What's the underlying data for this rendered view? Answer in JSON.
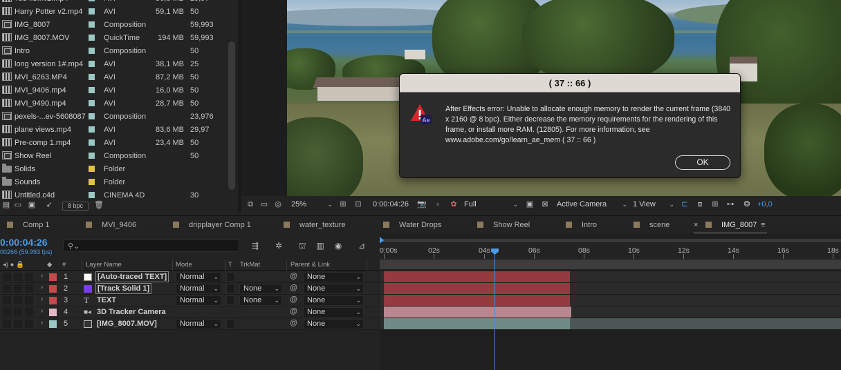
{
  "project": {
    "items": [
      {
        "name": "Ted fle...v2.mp4",
        "type": "AVI",
        "size": "56,8 MB",
        "fps": "29,97",
        "icon": "footage",
        "color": "#9bc7c4"
      },
      {
        "name": "Harry Potter v2.mp4",
        "type": "AVI",
        "size": "59,1 MB",
        "fps": "50",
        "icon": "footage",
        "color": "#9bc7c4"
      },
      {
        "name": "IMG_8007",
        "type": "Composition",
        "size": "",
        "fps": "59,993",
        "icon": "comp",
        "color": "#9bc7c4"
      },
      {
        "name": "IMG_8007.MOV",
        "type": "QuickTime",
        "size": "194 MB",
        "fps": "59,993",
        "icon": "footage",
        "color": "#9bc7c4"
      },
      {
        "name": "Intro",
        "type": "Composition",
        "size": "",
        "fps": "50",
        "icon": "comp",
        "color": "#9bc7c4"
      },
      {
        "name": "long version 1#.mp4",
        "type": "AVI",
        "size": "38,1 MB",
        "fps": "25",
        "icon": "footage",
        "color": "#9bc7c4"
      },
      {
        "name": "MVI_6263.MP4",
        "type": "AVI",
        "size": "87,2 MB",
        "fps": "50",
        "icon": "footage",
        "color": "#9bc7c4"
      },
      {
        "name": "MVI_9406.mp4",
        "type": "AVI",
        "size": "16,0 MB",
        "fps": "50",
        "icon": "footage",
        "color": "#9bc7c4"
      },
      {
        "name": "MVI_9490.mp4",
        "type": "AVI",
        "size": "28,7 MB",
        "fps": "50",
        "icon": "footage",
        "color": "#9bc7c4"
      },
      {
        "name": "pexels-...ev-5608087",
        "type": "Composition",
        "size": "",
        "fps": "23,976",
        "icon": "comp",
        "color": "#9bc7c4"
      },
      {
        "name": "plane views.mp4",
        "type": "AVI",
        "size": "83,6 MB",
        "fps": "29,97",
        "icon": "footage",
        "color": "#9bc7c4"
      },
      {
        "name": "Pre-comp 1.mp4",
        "type": "AVI",
        "size": "23,4 MB",
        "fps": "50",
        "icon": "footage",
        "color": "#9bc7c4"
      },
      {
        "name": "Show Reel",
        "type": "Composition",
        "size": "",
        "fps": "50",
        "icon": "comp",
        "color": "#9bc7c4"
      },
      {
        "name": "Solids",
        "type": "Folder",
        "size": "",
        "fps": "",
        "icon": "folder",
        "color": "#e0c43a"
      },
      {
        "name": "Sounds",
        "type": "Folder",
        "size": "",
        "fps": "",
        "icon": "folder",
        "color": "#e0c43a"
      },
      {
        "name": "Untitled.c4d",
        "type": "CINEMA 4D",
        "size": "",
        "fps": "30",
        "icon": "footage",
        "color": "#9bc7c4"
      }
    ],
    "bpc_label": "8 bpc"
  },
  "viewer": {
    "zoom": "25%",
    "timecode": "0:00:04:26",
    "resolution": "Full",
    "camera": "Active Camera",
    "views": "1 View",
    "exposure": "+0,0"
  },
  "dialog": {
    "title": "( 37 :: 66 )",
    "message": "After Effects error: Unable to allocate enough memory to render the current frame (3840 x 2160 @ 8 bpc). Either decrease the memory requirements for the rendering of this frame, or install more RAM. (12805). For more information, see www.adobe.com/go/learn_ae_mem ( 37 :: 66 )",
    "ok_label": "OK",
    "icon_badge": "Ae"
  },
  "tabs": [
    {
      "label": "Comp 1"
    },
    {
      "label": "MVI_9406"
    },
    {
      "label": "dripplayer Comp 1"
    },
    {
      "label": "water_texture"
    },
    {
      "label": "Water Drops"
    },
    {
      "label": "Show Reel"
    },
    {
      "label": "Intro"
    },
    {
      "label": "scene"
    },
    {
      "label": "IMG_8007",
      "active": true
    }
  ],
  "tab_close": "×",
  "tab_menu": "≡",
  "timeline": {
    "current_time": "0:00:04:26",
    "frame_info": "00266 (59.993 fps)",
    "columns": {
      "hash": "#",
      "layer_name": "Layer Name",
      "mode": "Mode",
      "t": "T",
      "trkmat": "TrkMat",
      "parent": "Parent & Link"
    },
    "layers": [
      {
        "num": "1",
        "name": "[Auto-traced TEXT]",
        "mode": "Normal",
        "trkmat": "",
        "parent": "None",
        "color": "#c24a4a",
        "icon": "white-solid"
      },
      {
        "num": "2",
        "name": "[Track Solid 1]",
        "mode": "Normal",
        "trkmat": "None",
        "parent": "None",
        "color": "#c24a4a",
        "icon": "purple-solid"
      },
      {
        "num": "3",
        "name": "TEXT",
        "mode": "Normal",
        "trkmat": "None",
        "parent": "None",
        "color": "#c24a4a",
        "icon": "text"
      },
      {
        "num": "4",
        "name": "3D Tracker Camera",
        "mode": "",
        "trkmat": "",
        "parent": "None",
        "color": "#e2b9c4",
        "icon": "camera"
      },
      {
        "num": "5",
        "name": "[IMG_8007.MOV]",
        "mode": "Normal",
        "trkmat": "",
        "parent": "None",
        "color": "#9bc7c4",
        "icon": "footage"
      }
    ],
    "ruler": [
      "0:00s",
      "02s",
      "04s",
      "06s",
      "08s",
      "10s",
      "12s",
      "14s",
      "16s",
      "18s"
    ],
    "bar_colors": [
      "#943a40",
      "#943a40",
      "#943a40",
      "#b8878f",
      "#6f8b87"
    ]
  }
}
